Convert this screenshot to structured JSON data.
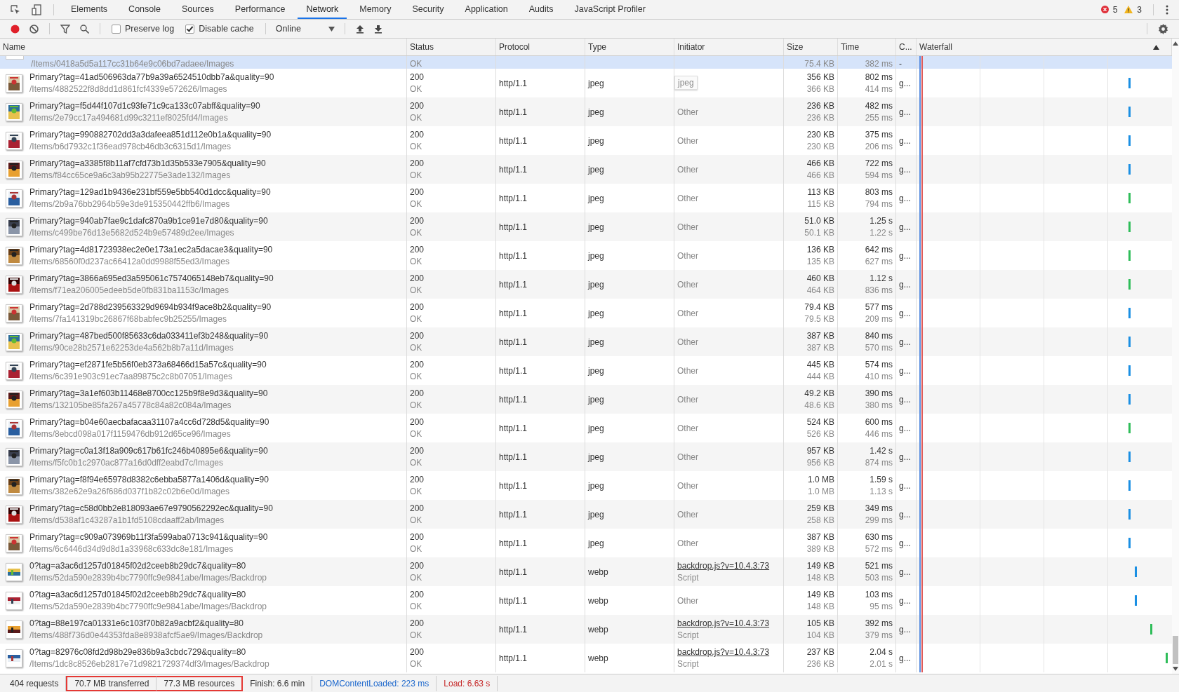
{
  "tabs": [
    {
      "label": "Elements",
      "selected": false
    },
    {
      "label": "Console",
      "selected": false
    },
    {
      "label": "Sources",
      "selected": false
    },
    {
      "label": "Performance",
      "selected": false
    },
    {
      "label": "Network",
      "selected": true
    },
    {
      "label": "Memory",
      "selected": false
    },
    {
      "label": "Security",
      "selected": false
    },
    {
      "label": "Application",
      "selected": false
    },
    {
      "label": "Audits",
      "selected": false
    },
    {
      "label": "JavaScript Profiler",
      "selected": false
    }
  ],
  "counters": {
    "errors": "5",
    "warnings": "3"
  },
  "toolbar": {
    "recording": true,
    "preserve_log": {
      "label": "Preserve log",
      "checked": false
    },
    "disable_cache": {
      "label": "Disable cache",
      "checked": true
    },
    "throttling": "Online"
  },
  "columns": [
    "Name",
    "Status",
    "Protocol",
    "Type",
    "Initiator",
    "Size",
    "Time",
    "C...",
    "Waterfall"
  ],
  "partial_row": {
    "path": "/Items/0418a5d5a117cc31b64e9c06bd7adaee/Images",
    "status_text": "OK",
    "resource_size": "75.4 KB",
    "latency": "382 ms",
    "col_c": "-",
    "selected": true
  },
  "rows": [
    {
      "name": "Primary?tag=41ad506963da77b9a39a6524510dbb7a&quality=90",
      "path": "/Items/4882522f8d8dd1d861fcf4339e572626/Images",
      "status": "200",
      "status_text": "OK",
      "protocol": "http/1.1",
      "type": "jpeg",
      "tooltip": "jpeg",
      "size": "356 KB",
      "resource_size": "366 KB",
      "time": "802 ms",
      "latency": "414 ms",
      "col_c": "g...",
      "color": "#1a8fe3",
      "selected": false
    },
    {
      "name": "Primary?tag=f5d44f107d1c93fe71c9ca133c07abff&quality=90",
      "path": "/Items/2e79cc17a494681d99c3211ef8025fd4/Images",
      "status": "200",
      "status_text": "OK",
      "protocol": "http/1.1",
      "type": "jpeg",
      "initiator": {
        "kind": "other",
        "text": "Other"
      },
      "size": "236 KB",
      "resource_size": "236 KB",
      "time": "482 ms",
      "latency": "255 ms",
      "col_c": "g...",
      "color": "#1a8fe3",
      "selected": false
    },
    {
      "name": "Primary?tag=990882702dd3a3dafeea851d112e0b1a&quality=90",
      "path": "/Items/b6d7932c1f36ead978cb46db3c6315d1/Images",
      "status": "200",
      "status_text": "OK",
      "protocol": "http/1.1",
      "type": "jpeg",
      "initiator": {
        "kind": "other",
        "text": "Other"
      },
      "size": "230 KB",
      "resource_size": "230 KB",
      "time": "375 ms",
      "latency": "206 ms",
      "col_c": "g...",
      "color": "#1a8fe3",
      "selected": false
    },
    {
      "name": "Primary?tag=a3385f8b11af7cfd73b1d35b533e7905&quality=90",
      "path": "/Items/f84cc65ce9a6c3ab95b22775e3ade132/Images",
      "status": "200",
      "status_text": "OK",
      "protocol": "http/1.1",
      "type": "jpeg",
      "initiator": {
        "kind": "other",
        "text": "Other"
      },
      "size": "466 KB",
      "resource_size": "466 KB",
      "time": "722 ms",
      "latency": "594 ms",
      "col_c": "g...",
      "color": "#1a8fe3",
      "selected": false
    },
    {
      "name": "Primary?tag=129ad1b9436e231bf559e5bb540d1dcc&quality=90",
      "path": "/Items/2b9a76bb2964b59e3de915350442ffb6/Images",
      "status": "200",
      "status_text": "OK",
      "protocol": "http/1.1",
      "type": "jpeg",
      "initiator": {
        "kind": "other",
        "text": "Other"
      },
      "size": "113 KB",
      "resource_size": "115 KB",
      "time": "803 ms",
      "latency": "794 ms",
      "col_c": "g...",
      "color": "#2ebd59",
      "selected": false
    },
    {
      "name": "Primary?tag=940ab7fae9c1dafc870a9b1ce91e7d80&quality=90",
      "path": "/Items/c499be76d13e5682d524b9e57489d2ee/Images",
      "status": "200",
      "status_text": "OK",
      "protocol": "http/1.1",
      "type": "jpeg",
      "initiator": {
        "kind": "other",
        "text": "Other"
      },
      "size": "51.0 KB",
      "resource_size": "50.1 KB",
      "time": "1.25 s",
      "latency": "1.22 s",
      "col_c": "g...",
      "color": "#2ebd59",
      "selected": false
    },
    {
      "name": "Primary?tag=4d81723938ec2e0e173a1ec2a5dacae3&quality=90",
      "path": "/Items/68560f0d237ac66412a0dd9988f55ed3/Images",
      "status": "200",
      "status_text": "OK",
      "protocol": "http/1.1",
      "type": "jpeg",
      "initiator": {
        "kind": "other",
        "text": "Other"
      },
      "size": "136 KB",
      "resource_size": "135 KB",
      "time": "642 ms",
      "latency": "627 ms",
      "col_c": "g...",
      "color": "#2ebd59",
      "selected": false
    },
    {
      "name": "Primary?tag=3866a695ed3a595061c7574065148eb7&quality=90",
      "path": "/Items/f71ea206005edeeb5de0fb831ba1153c/Images",
      "status": "200",
      "status_text": "OK",
      "protocol": "http/1.1",
      "type": "jpeg",
      "initiator": {
        "kind": "other",
        "text": "Other"
      },
      "size": "460 KB",
      "resource_size": "464 KB",
      "time": "1.12 s",
      "latency": "836 ms",
      "col_c": "g...",
      "color": "#2ebd59",
      "selected": false
    },
    {
      "name": "Primary?tag=2d788d239563329d9694b934f9ace8b2&quality=90",
      "path": "/Items/7fa141319bc26867f68babfec9b25255/Images",
      "status": "200",
      "status_text": "OK",
      "protocol": "http/1.1",
      "type": "jpeg",
      "initiator": {
        "kind": "other",
        "text": "Other"
      },
      "size": "79.4 KB",
      "resource_size": "79.5 KB",
      "time": "577 ms",
      "latency": "209 ms",
      "col_c": "g...",
      "color": "#1a8fe3",
      "selected": false
    },
    {
      "name": "Primary?tag=487bed500f85633c6da033411ef3b248&quality=90",
      "path": "/Items/90ce28b2571e62253de4a562b8b7a11d/Images",
      "status": "200",
      "status_text": "OK",
      "protocol": "http/1.1",
      "type": "jpeg",
      "initiator": {
        "kind": "other",
        "text": "Other"
      },
      "size": "387 KB",
      "resource_size": "387 KB",
      "time": "840 ms",
      "latency": "570 ms",
      "col_c": "g...",
      "color": "#1a8fe3",
      "selected": false
    },
    {
      "name": "Primary?tag=ef2871fe5b56f0eb373a68466d15a57c&quality=90",
      "path": "/Items/6c391e903c91ec7aa89875c2c8b07051/Images",
      "status": "200",
      "status_text": "OK",
      "protocol": "http/1.1",
      "type": "jpeg",
      "initiator": {
        "kind": "other",
        "text": "Other"
      },
      "size": "445 KB",
      "resource_size": "444 KB",
      "time": "574 ms",
      "latency": "410 ms",
      "col_c": "g...",
      "color": "#1a8fe3",
      "selected": false
    },
    {
      "name": "Primary?tag=3a1ef603b11468e8700cc125b9f8e9d3&quality=90",
      "path": "/Items/132105be85fa267a45778c84a82c084a/Images",
      "status": "200",
      "status_text": "OK",
      "protocol": "http/1.1",
      "type": "jpeg",
      "initiator": {
        "kind": "other",
        "text": "Other"
      },
      "size": "49.2 KB",
      "resource_size": "48.6 KB",
      "time": "390 ms",
      "latency": "380 ms",
      "col_c": "g...",
      "color": "#1a8fe3",
      "selected": false
    },
    {
      "name": "Primary?tag=b04e60aecbafacaa31107a4cc6d728d5&quality=90",
      "path": "/Items/8ebcd098a017f1159476db912d65ce96/Images",
      "status": "200",
      "status_text": "OK",
      "protocol": "http/1.1",
      "type": "jpeg",
      "initiator": {
        "kind": "other",
        "text": "Other"
      },
      "size": "524 KB",
      "resource_size": "526 KB",
      "time": "600 ms",
      "latency": "446 ms",
      "col_c": "g...",
      "color": "#2ebd59",
      "selected": false
    },
    {
      "name": "Primary?tag=c0a13f18a909c617b61fc246b40895e6&quality=90",
      "path": "/Items/f5fc0b1c2970ac877a16d0dff2eabd7c/Images",
      "status": "200",
      "status_text": "OK",
      "protocol": "http/1.1",
      "type": "jpeg",
      "initiator": {
        "kind": "other",
        "text": "Other"
      },
      "size": "957 KB",
      "resource_size": "956 KB",
      "time": "1.42 s",
      "latency": "874 ms",
      "col_c": "g...",
      "color": "#1a8fe3",
      "selected": false
    },
    {
      "name": "Primary?tag=f8f94e65978d8382c6ebba5877a1406d&quality=90",
      "path": "/Items/382e62e9a26f686d037f1b82c02b6e0d/Images",
      "status": "200",
      "status_text": "OK",
      "protocol": "http/1.1",
      "type": "jpeg",
      "initiator": {
        "kind": "other",
        "text": "Other"
      },
      "size": "1.0 MB",
      "resource_size": "1.0 MB",
      "time": "1.59 s",
      "latency": "1.13 s",
      "col_c": "g...",
      "color": "#1a8fe3",
      "selected": false
    },
    {
      "name": "Primary?tag=c58d0bb2e818093ae67e9790562292ec&quality=90",
      "path": "/Items/d538af1c43287a1b1fd5108cdaaff2ab/Images",
      "status": "200",
      "status_text": "OK",
      "protocol": "http/1.1",
      "type": "jpeg",
      "initiator": {
        "kind": "other",
        "text": "Other"
      },
      "size": "259 KB",
      "resource_size": "258 KB",
      "time": "349 ms",
      "latency": "299 ms",
      "col_c": "g...",
      "color": "#1a8fe3",
      "selected": false
    },
    {
      "name": "Primary?tag=c909a073969b11f3fa599aba0713c941&quality=90",
      "path": "/Items/6c6446d34d9d8d1a33968c633dc8e181/Images",
      "status": "200",
      "status_text": "OK",
      "protocol": "http/1.1",
      "type": "jpeg",
      "initiator": {
        "kind": "other",
        "text": "Other"
      },
      "size": "387 KB",
      "resource_size": "389 KB",
      "time": "630 ms",
      "latency": "572 ms",
      "col_c": "g...",
      "color": "#1a8fe3",
      "selected": false
    },
    {
      "name": "0?tag=a3ac6d1257d01845f02d2ceeb8b29dc7&quality=80",
      "path": "/Items/52da590e2839b4bc7790ffc9e9841abe/Images/Backdrop",
      "status": "200",
      "status_text": "OK",
      "protocol": "http/1.1",
      "type": "webp",
      "initiator": {
        "kind": "script",
        "link": "backdrop.js?v=10.4.3:73",
        "text": "Script"
      },
      "size": "149 KB",
      "resource_size": "148 KB",
      "time": "521 ms",
      "latency": "503 ms",
      "col_c": "g...",
      "color": "#1a8fe3",
      "selected": false
    },
    {
      "name": "0?tag=a3ac6d1257d01845f02d2ceeb8b29dc7&quality=80",
      "path": "/Items/52da590e2839b4bc7790ffc9e9841abe/Images/Backdrop",
      "status": "200",
      "status_text": "OK",
      "protocol": "http/1.1",
      "type": "webp",
      "initiator": {
        "kind": "other",
        "text": "Other"
      },
      "size": "149 KB",
      "resource_size": "148 KB",
      "time": "103 ms",
      "latency": "95 ms",
      "col_c": "g...",
      "color": "#1a8fe3",
      "selected": false
    },
    {
      "name": "0?tag=88e197ca01331e6c103f70b82a9acbf2&quality=80",
      "path": "/Items/488f736d0e44353fda8e8938afcf5ae9/Images/Backdrop",
      "status": "200",
      "status_text": "OK",
      "protocol": "http/1.1",
      "type": "webp",
      "initiator": {
        "kind": "script",
        "link": "backdrop.js?v=10.4.3:73",
        "text": "Script"
      },
      "size": "105 KB",
      "resource_size": "104 KB",
      "time": "392 ms",
      "latency": "379 ms",
      "col_c": "g...",
      "color": "#2ebd59",
      "selected": false
    },
    {
      "name": "0?tag=82976c08fd2d98b29e836b9a3cbdc729&quality=80",
      "path": "/Items/1dc8c8526eb2817e71d9821729374df3/Images/Backdrop",
      "status": "200",
      "status_text": "OK",
      "protocol": "http/1.1",
      "type": "webp",
      "initiator": {
        "kind": "script",
        "link": "backdrop.js?v=10.4.3:73",
        "text": "Script"
      },
      "size": "237 KB",
      "resource_size": "236 KB",
      "time": "2.04 s",
      "latency": "2.01 s",
      "col_c": "g...",
      "color": "#2ebd59",
      "selected": false
    }
  ],
  "status_bar": [
    {
      "text": "404 requests",
      "kind": "plain",
      "highlighted": false
    },
    {
      "text": "70.7 MB transferred",
      "kind": "plain",
      "highlighted": true
    },
    {
      "text": "77.3 MB resources",
      "kind": "plain",
      "highlighted": true
    },
    {
      "text": "Finish: 6.6 min",
      "kind": "plain",
      "highlighted": false
    },
    {
      "text": "DOMContentLoaded: 223 ms",
      "kind": "dom",
      "highlighted": false
    },
    {
      "text": "Load: 6.63 s",
      "kind": "load",
      "highlighted": false
    }
  ]
}
